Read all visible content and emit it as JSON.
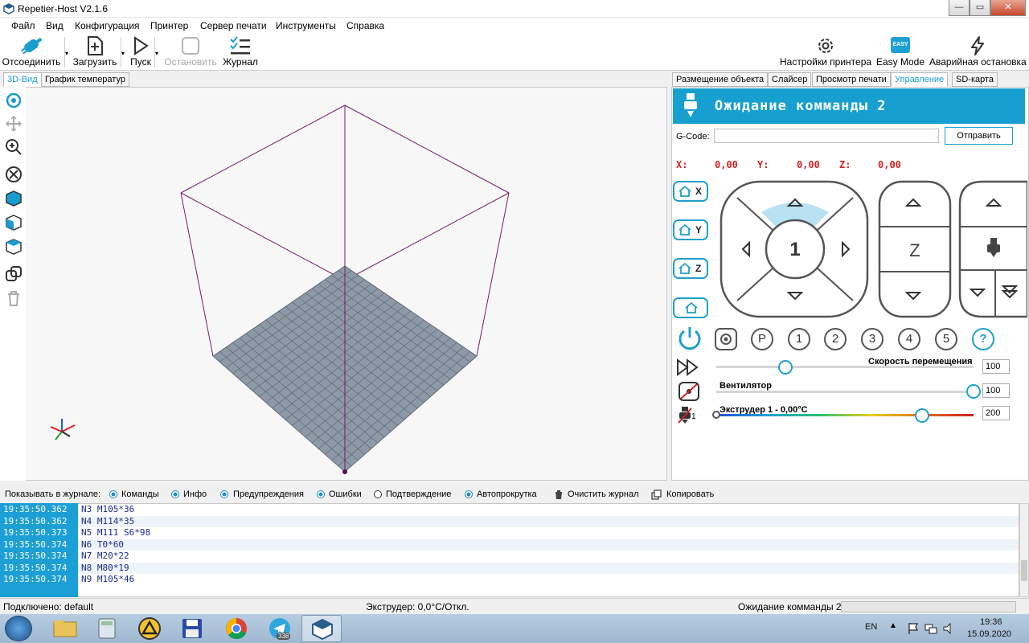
{
  "window": {
    "title": "Repetier-Host V2.1.6",
    "controls": {
      "minimize": "—",
      "maximize": "▭",
      "close": "✕"
    }
  },
  "menu": [
    "Файл",
    "Вид",
    "Конфигурация",
    "Принтер",
    "Сервер печати",
    "Инструменты",
    "Справка"
  ],
  "toolbar": {
    "disconnect": "Отсоединить",
    "load": "Загрузить",
    "run": "Пуск",
    "stop": "Остановить",
    "log": "Журнал",
    "printer_settings": "Настройки принтера",
    "easy_mode": "Easy Mode",
    "easy_badge": "EASY",
    "emergency_stop": "Аварийная остановка"
  },
  "left_tabs": [
    "3D-Вид",
    "График температур"
  ],
  "right_tabs": [
    "Размещение объекта",
    "Слайсер",
    "Просмотр печати",
    "Управление",
    "SD-карта"
  ],
  "control": {
    "status": "Ожидание комманды 2",
    "gcode_label": "G-Code:",
    "gcode_value": "",
    "send": "Отправить",
    "x_label": "X:",
    "x_value": "0,00",
    "y_label": "Y:",
    "y_value": "0,00",
    "z_label": "Z:",
    "z_value": "0,00",
    "home_x": "X",
    "home_y": "Y",
    "home_z": "Z",
    "xy_step": "1",
    "z_label_big": "Z",
    "buttons": [
      "P",
      "1",
      "2",
      "3",
      "4",
      "5",
      "?"
    ],
    "speed_label": "Скорость перемещения",
    "speed_value": "100",
    "speed_level": 0.27,
    "fan_label": "Вентилятор",
    "fan_value": "100",
    "fan_level": 1.0,
    "extruder_label": "Экструдер 1 - 0,00°C",
    "extruder_value": "200",
    "extruder_level": 0.8,
    "extruder_index": "1"
  },
  "logbar": {
    "show_label": "Показывать в журнале:",
    "commands": "Команды",
    "info": "Инфо",
    "warnings": "Предупреждения",
    "errors": "Ошибки",
    "ack": "Подтверждение",
    "autoscroll": "Автопрокрутка",
    "clear": "Очистить журнал",
    "copy": "Копировать"
  },
  "log": [
    {
      "time": "19:35:50.362",
      "msg": "N3 M105*36"
    },
    {
      "time": "19:35:50.362",
      "msg": "N4 M114*35"
    },
    {
      "time": "19:35:50.373",
      "msg": "N5 M111 S6*98"
    },
    {
      "time": "19:35:50.374",
      "msg": "N6 T0*60"
    },
    {
      "time": "19:35:50.374",
      "msg": "N7 M20*22"
    },
    {
      "time": "19:35:50.374",
      "msg": "N8 M80*19"
    },
    {
      "time": "19:35:50.374",
      "msg": "N9 M105*46"
    }
  ],
  "statusbar": {
    "connected": "Подключено: default",
    "extruder": "Экструдер: 0,0°C/Откл.",
    "state": "Ожидание комманды 2"
  },
  "taskbar": {
    "lang": "EN",
    "time": "19:36",
    "date": "15.09.2020",
    "telegram_badge": "338"
  },
  "colors": {
    "accent": "#169fcf",
    "coord_red": "#d32121",
    "box_line": "#7a1a6a",
    "bed": "#8d99a6"
  }
}
